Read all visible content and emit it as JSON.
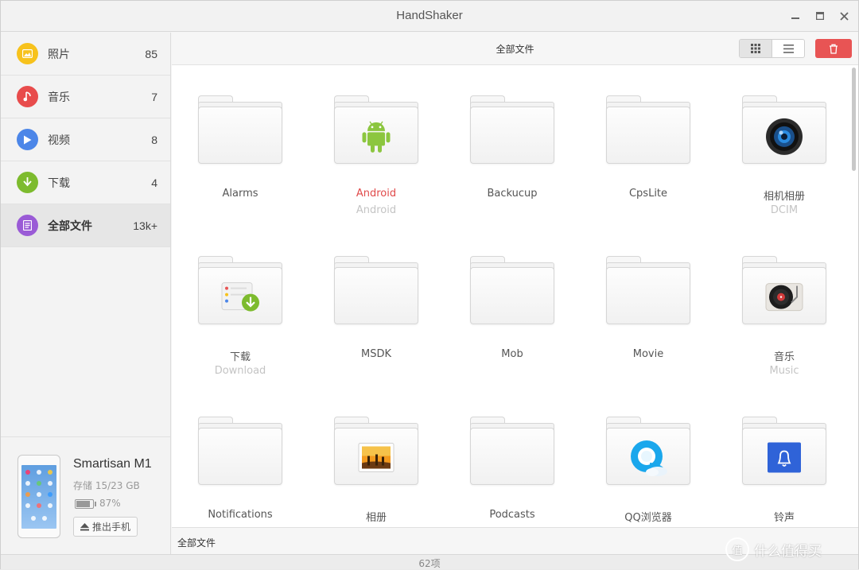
{
  "window": {
    "title": "HandShaker"
  },
  "sidebar": {
    "items": [
      {
        "label": "照片",
        "count": "85",
        "icon": "photo-icon",
        "color": "#f7c21c"
      },
      {
        "label": "音乐",
        "count": "7",
        "icon": "music-icon",
        "color": "#e84c4c"
      },
      {
        "label": "视频",
        "count": "8",
        "icon": "video-icon",
        "color": "#4c86e8"
      },
      {
        "label": "下载",
        "count": "4",
        "icon": "download-icon",
        "color": "#7dbb2e"
      },
      {
        "label": "全部文件",
        "count": "13k+",
        "icon": "files-icon",
        "color": "#9a5bd6",
        "active": true
      }
    ]
  },
  "device": {
    "name": "Smartisan M1",
    "storage": "存储 15/23 GB",
    "battery": "87%",
    "battery_level": 0.87,
    "eject_label": "推出手机"
  },
  "toolbar": {
    "title": "全部文件"
  },
  "files": [
    {
      "name": "Alarms",
      "sub": "",
      "badge": ""
    },
    {
      "name": "Android",
      "sub": "Android",
      "badge": "android-icon",
      "selected": true
    },
    {
      "name": "Backucup",
      "sub": "",
      "badge": ""
    },
    {
      "name": "CpsLite",
      "sub": "",
      "badge": ""
    },
    {
      "name": "相机相册",
      "sub": "DCIM",
      "badge": "camera-icon"
    },
    {
      "name": "下载",
      "sub": "Download",
      "badge": "download-folder-icon"
    },
    {
      "name": "MSDK",
      "sub": "",
      "badge": ""
    },
    {
      "name": "Mob",
      "sub": "",
      "badge": ""
    },
    {
      "name": "Movie",
      "sub": "",
      "badge": ""
    },
    {
      "name": "音乐",
      "sub": "Music",
      "badge": "record-player-icon"
    },
    {
      "name": "Notifications",
      "sub": "",
      "badge": ""
    },
    {
      "name": "相册",
      "sub": "",
      "badge": "photo-album-icon"
    },
    {
      "name": "Podcasts",
      "sub": "",
      "badge": ""
    },
    {
      "name": "QQ浏览器",
      "sub": "",
      "badge": "qq-browser-icon"
    },
    {
      "name": "铃声",
      "sub": "",
      "badge": "bell-icon"
    }
  ],
  "pathbar": {
    "path": "全部文件"
  },
  "status": {
    "text": "62项"
  },
  "watermark": {
    "text": "什么值得买",
    "glyph": "值"
  },
  "colors": {
    "delete": "#e85454",
    "selected_label": "#e04a4a",
    "accent": "#4c86e8"
  }
}
